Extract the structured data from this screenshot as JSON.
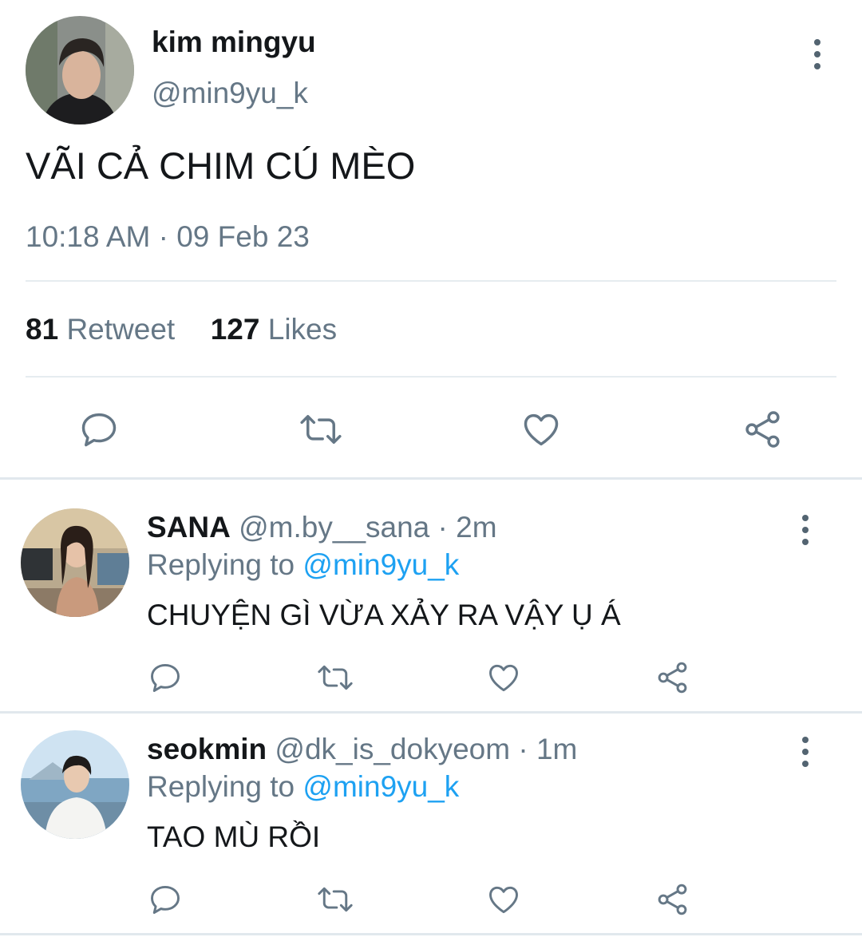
{
  "tweet": {
    "author_name": "kim mingyu",
    "author_handle": "@min9yu_k",
    "text": "VÃI CẢ CHIM CÚ MÈO",
    "time": "10:18 AM",
    "date": "09 Feb 23",
    "retweet_count": "81",
    "retweet_label": "Retweet",
    "likes_count": "127",
    "likes_label": "Likes"
  },
  "replies": [
    {
      "name": "SANA",
      "handle": "@m.by__sana",
      "time": "2m",
      "replying_label": "Replying to",
      "replying_handle": "@min9yu_k",
      "text": "CHUYỆN GÌ VỪA XẢY RA VẬY Ụ Á"
    },
    {
      "name": "seokmin",
      "handle": "@dk_is_dokyeom",
      "time": "1m",
      "replying_label": "Replying to",
      "replying_handle": "@min9yu_k",
      "text": "TAO MÙ RỒI"
    }
  ],
  "separator": "·",
  "icons": [
    "reply-icon",
    "retweet-icon",
    "like-icon",
    "share-icon",
    "more-options-icon"
  ],
  "colors": {
    "link": "#1da1f2",
    "secondary_text": "#657786",
    "primary_text": "#14171a"
  }
}
